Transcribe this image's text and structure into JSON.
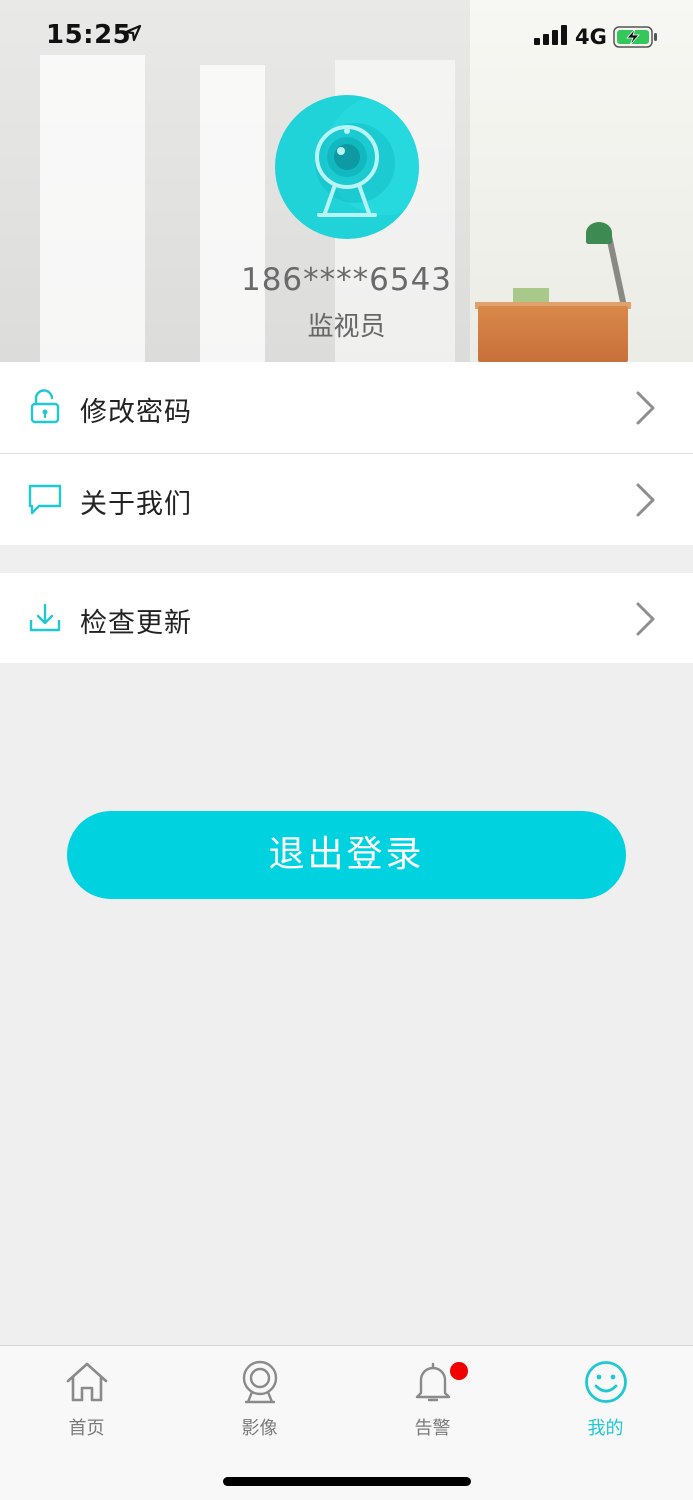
{
  "status_bar": {
    "time": "15:25",
    "network": "4G",
    "icons": [
      "location-arrow-icon",
      "signal-bars-icon",
      "battery-charging-icon"
    ]
  },
  "profile": {
    "avatar_icon": "camera-icon",
    "phone": "186****6543",
    "role": "监视员"
  },
  "menu": {
    "group1": [
      {
        "label": "修改密码",
        "icon": "lock-icon"
      },
      {
        "label": "关于我们",
        "icon": "chat-bubble-icon"
      }
    ],
    "group2": [
      {
        "label": "检查更新",
        "icon": "download-icon"
      }
    ]
  },
  "logout": {
    "label": "退出登录"
  },
  "tabs": [
    {
      "label": "首页",
      "icon": "home-icon",
      "active": false
    },
    {
      "label": "影像",
      "icon": "camera-icon",
      "active": false
    },
    {
      "label": "告警",
      "icon": "bell-icon",
      "active": false,
      "badge": true
    },
    {
      "label": "我的",
      "icon": "smiley-icon",
      "active": true
    }
  ],
  "colors": {
    "accent": "#00d2e0",
    "badge": "#f20000",
    "avatar_bg": "#1fd3d8"
  }
}
